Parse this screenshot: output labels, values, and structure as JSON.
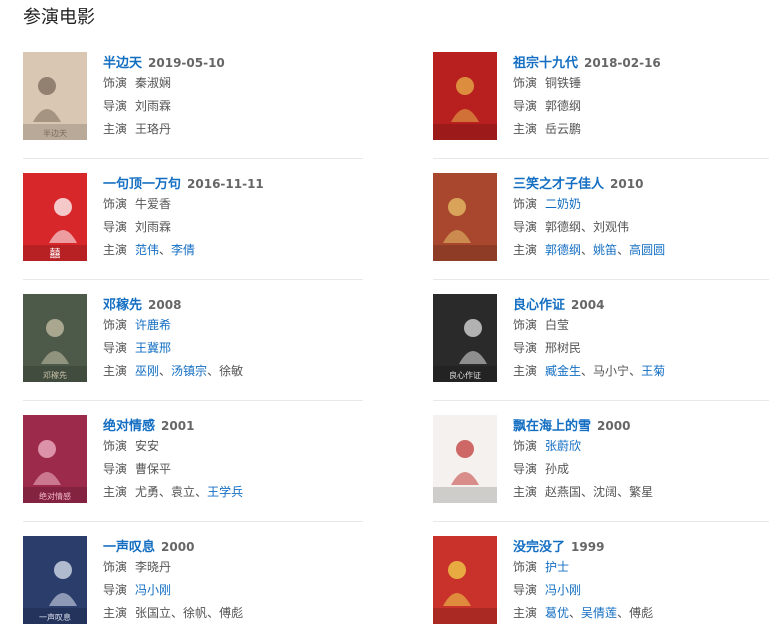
{
  "section_title": "参演电影",
  "labels": {
    "role": "饰演",
    "director": "导演",
    "starring": "主演"
  },
  "films": [
    {
      "title": "半边天",
      "year": "2019-05-10",
      "role": [
        {
          "name": "秦淑娴",
          "link": false
        }
      ],
      "director": [
        {
          "name": "刘雨霖",
          "link": false
        }
      ],
      "starring": [
        {
          "name": "王珞丹",
          "link": false
        }
      ],
      "poster": {
        "icon": "film-poster",
        "bg": "#d9c7b3",
        "accent": "#7a6a5a",
        "caption": "半边天"
      }
    },
    {
      "title": "祖宗十九代",
      "year": "2018-02-16",
      "role": [
        {
          "name": "铜铁锤",
          "link": false
        }
      ],
      "director": [
        {
          "name": "郭德纲",
          "link": false
        }
      ],
      "starring": [
        {
          "name": "岳云鹏",
          "link": false
        }
      ],
      "poster": {
        "icon": "film-poster",
        "bg": "#b81f1f",
        "accent": "#e8b44a",
        "caption": ""
      }
    },
    {
      "title": "一句顶一万句",
      "year": "2016-11-11",
      "role": [
        {
          "name": "牛爱香",
          "link": false
        }
      ],
      "director": [
        {
          "name": "刘雨霖",
          "link": false
        }
      ],
      "starring": [
        {
          "name": "范伟",
          "link": true
        },
        {
          "name": "李倩",
          "link": true
        }
      ],
      "poster": {
        "icon": "film-poster",
        "bg": "#d8272b",
        "accent": "#ffffff",
        "caption": "囍"
      }
    },
    {
      "title": "三笑之才子佳人",
      "year": "2010",
      "role": [
        {
          "name": "二奶奶",
          "link": true
        }
      ],
      "director": [
        {
          "name": "郭德纲",
          "link": false
        },
        {
          "name": "刘观伟",
          "link": false
        }
      ],
      "starring": [
        {
          "name": "郭德纲",
          "link": true
        },
        {
          "name": "姚笛",
          "link": true
        },
        {
          "name": "高圆圆",
          "link": true
        }
      ],
      "poster": {
        "icon": "film-poster",
        "bg": "#a8472e",
        "accent": "#e9c36a",
        "caption": ""
      }
    },
    {
      "title": "邓稼先",
      "year": "2008",
      "role": [
        {
          "name": "许鹿希",
          "link": true
        }
      ],
      "director": [
        {
          "name": "王冀邢",
          "link": true
        }
      ],
      "starring": [
        {
          "name": "巫刚",
          "link": true
        },
        {
          "name": "汤镇宗",
          "link": true
        },
        {
          "name": "徐敏",
          "link": false
        }
      ],
      "poster": {
        "icon": "film-poster",
        "bg": "#4d5a4a",
        "accent": "#c9c2a8",
        "caption": "邓稼先"
      }
    },
    {
      "title": "良心作证",
      "year": "2004",
      "role": [
        {
          "name": "白莹",
          "link": false
        }
      ],
      "director": [
        {
          "name": "邢树民",
          "link": false
        }
      ],
      "starring": [
        {
          "name": "臧金生",
          "link": true
        },
        {
          "name": "马小宁",
          "link": false
        },
        {
          "name": "王菊",
          "link": true
        }
      ],
      "poster": {
        "icon": "film-poster",
        "bg": "#2a2a2a",
        "accent": "#e0e0e0",
        "caption": "良心作证"
      }
    },
    {
      "title": "绝对情感",
      "year": "2001",
      "role": [
        {
          "name": "安安",
          "link": false
        }
      ],
      "director": [
        {
          "name": "曹保平",
          "link": false
        }
      ],
      "starring": [
        {
          "name": "尤勇",
          "link": false
        },
        {
          "name": "袁立",
          "link": false
        },
        {
          "name": "王学兵",
          "link": true
        }
      ],
      "poster": {
        "icon": "film-poster",
        "bg": "#9c2a4a",
        "accent": "#f2b6c9",
        "caption": "绝对情感"
      }
    },
    {
      "title": "飘在海上的雪",
      "year": "2000",
      "role": [
        {
          "name": "张蔚欣",
          "link": true
        }
      ],
      "director": [
        {
          "name": "孙成",
          "link": false
        }
      ],
      "starring": [
        {
          "name": "赵燕国",
          "link": false
        },
        {
          "name": "沈阔",
          "link": false
        },
        {
          "name": "繁星",
          "link": false
        }
      ],
      "poster": {
        "icon": "film-poster",
        "bg": "#f4f1ee",
        "accent": "#c23a3a",
        "caption": ""
      }
    },
    {
      "title": "一声叹息",
      "year": "2000",
      "role": [
        {
          "name": "李晓丹",
          "link": false
        }
      ],
      "director": [
        {
          "name": "冯小刚",
          "link": true
        }
      ],
      "starring": [
        {
          "name": "张国立",
          "link": false
        },
        {
          "name": "徐帆",
          "link": false
        },
        {
          "name": "傅彪",
          "link": false
        }
      ],
      "poster": {
        "icon": "film-poster",
        "bg": "#2b3d6b",
        "accent": "#dfe5f2",
        "caption": "一声叹息"
      }
    },
    {
      "title": "没完没了",
      "year": "1999",
      "role": [
        {
          "name": "护士",
          "link": true
        }
      ],
      "director": [
        {
          "name": "冯小刚",
          "link": true
        }
      ],
      "starring": [
        {
          "name": "葛优",
          "link": true
        },
        {
          "name": "吴倩莲",
          "link": true
        },
        {
          "name": "傅彪",
          "link": false
        }
      ],
      "poster": {
        "icon": "film-poster",
        "bg": "#c8322a",
        "accent": "#f3d44a",
        "caption": ""
      }
    }
  ]
}
